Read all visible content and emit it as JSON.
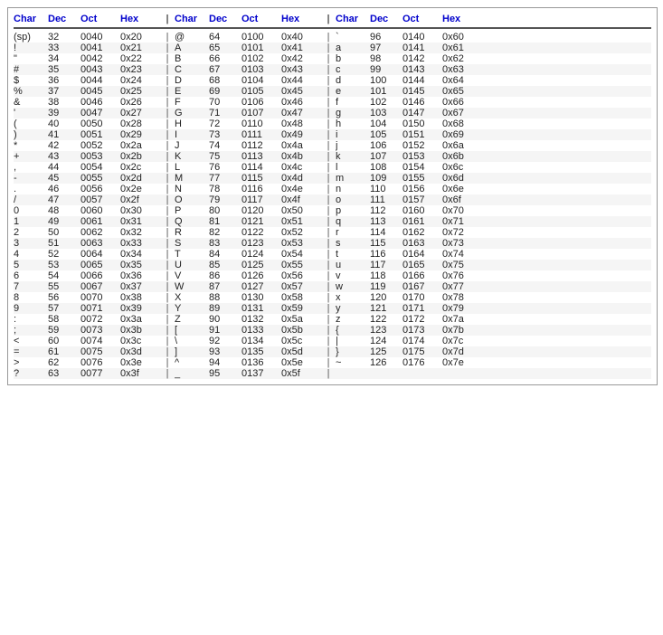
{
  "columns": [
    {
      "id": "char",
      "label": "Char"
    },
    {
      "id": "dec",
      "label": "Dec"
    },
    {
      "id": "oct",
      "label": "Oct"
    },
    {
      "id": "hex",
      "label": "Hex"
    }
  ],
  "rows": [
    [
      "(sp)",
      "32",
      "0040",
      "0x20",
      "@",
      "64",
      "0100",
      "0x40",
      "`",
      "96",
      "0140",
      "0x60"
    ],
    [
      "!",
      "33",
      "0041",
      "0x21",
      "A",
      "65",
      "0101",
      "0x41",
      "a",
      "97",
      "0141",
      "0x61"
    ],
    [
      "\"",
      "34",
      "0042",
      "0x22",
      "B",
      "66",
      "0102",
      "0x42",
      "b",
      "98",
      "0142",
      "0x62"
    ],
    [
      "#",
      "35",
      "0043",
      "0x23",
      "C",
      "67",
      "0103",
      "0x43",
      "c",
      "99",
      "0143",
      "0x63"
    ],
    [
      "$",
      "36",
      "0044",
      "0x24",
      "D",
      "68",
      "0104",
      "0x44",
      "d",
      "100",
      "0144",
      "0x64"
    ],
    [
      "%",
      "37",
      "0045",
      "0x25",
      "E",
      "69",
      "0105",
      "0x45",
      "e",
      "101",
      "0145",
      "0x65"
    ],
    [
      "&",
      "38",
      "0046",
      "0x26",
      "F",
      "70",
      "0106",
      "0x46",
      "f",
      "102",
      "0146",
      "0x66"
    ],
    [
      "'",
      "39",
      "0047",
      "0x27",
      "G",
      "71",
      "0107",
      "0x47",
      "g",
      "103",
      "0147",
      "0x67"
    ],
    [
      "(",
      "40",
      "0050",
      "0x28",
      "H",
      "72",
      "0110",
      "0x48",
      "h",
      "104",
      "0150",
      "0x68"
    ],
    [
      ")",
      "41",
      "0051",
      "0x29",
      "I",
      "73",
      "0111",
      "0x49",
      "i",
      "105",
      "0151",
      "0x69"
    ],
    [
      "*",
      "42",
      "0052",
      "0x2a",
      "J",
      "74",
      "0112",
      "0x4a",
      "j",
      "106",
      "0152",
      "0x6a"
    ],
    [
      "+",
      "43",
      "0053",
      "0x2b",
      "K",
      "75",
      "0113",
      "0x4b",
      "k",
      "107",
      "0153",
      "0x6b"
    ],
    [
      ",",
      "44",
      "0054",
      "0x2c",
      "L",
      "76",
      "0114",
      "0x4c",
      "l",
      "108",
      "0154",
      "0x6c"
    ],
    [
      "-",
      "45",
      "0055",
      "0x2d",
      "M",
      "77",
      "0115",
      "0x4d",
      "m",
      "109",
      "0155",
      "0x6d"
    ],
    [
      ".",
      "46",
      "0056",
      "0x2e",
      "N",
      "78",
      "0116",
      "0x4e",
      "n",
      "110",
      "0156",
      "0x6e"
    ],
    [
      "/",
      "47",
      "0057",
      "0x2f",
      "O",
      "79",
      "0117",
      "0x4f",
      "o",
      "111",
      "0157",
      "0x6f"
    ],
    [
      "0",
      "48",
      "0060",
      "0x30",
      "P",
      "80",
      "0120",
      "0x50",
      "p",
      "112",
      "0160",
      "0x70"
    ],
    [
      "1",
      "49",
      "0061",
      "0x31",
      "Q",
      "81",
      "0121",
      "0x51",
      "q",
      "113",
      "0161",
      "0x71"
    ],
    [
      "2",
      "50",
      "0062",
      "0x32",
      "R",
      "82",
      "0122",
      "0x52",
      "r",
      "114",
      "0162",
      "0x72"
    ],
    [
      "3",
      "51",
      "0063",
      "0x33",
      "S",
      "83",
      "0123",
      "0x53",
      "s",
      "115",
      "0163",
      "0x73"
    ],
    [
      "4",
      "52",
      "0064",
      "0x34",
      "T",
      "84",
      "0124",
      "0x54",
      "t",
      "116",
      "0164",
      "0x74"
    ],
    [
      "5",
      "53",
      "0065",
      "0x35",
      "U",
      "85",
      "0125",
      "0x55",
      "u",
      "117",
      "0165",
      "0x75"
    ],
    [
      "6",
      "54",
      "0066",
      "0x36",
      "V",
      "86",
      "0126",
      "0x56",
      "v",
      "118",
      "0166",
      "0x76"
    ],
    [
      "7",
      "55",
      "0067",
      "0x37",
      "W",
      "87",
      "0127",
      "0x57",
      "w",
      "119",
      "0167",
      "0x77"
    ],
    [
      "8",
      "56",
      "0070",
      "0x38",
      "X",
      "88",
      "0130",
      "0x58",
      "x",
      "120",
      "0170",
      "0x78"
    ],
    [
      "9",
      "57",
      "0071",
      "0x39",
      "Y",
      "89",
      "0131",
      "0x59",
      "y",
      "121",
      "0171",
      "0x79"
    ],
    [
      ":",
      "58",
      "0072",
      "0x3a",
      "Z",
      "90",
      "0132",
      "0x5a",
      "z",
      "122",
      "0172",
      "0x7a"
    ],
    [
      ";",
      "59",
      "0073",
      "0x3b",
      "[",
      "91",
      "0133",
      "0x5b",
      "{",
      "123",
      "0173",
      "0x7b"
    ],
    [
      "<",
      "60",
      "0074",
      "0x3c",
      "\\",
      "92",
      "0134",
      "0x5c",
      "|",
      "124",
      "0174",
      "0x7c"
    ],
    [
      "=",
      "61",
      "0075",
      "0x3d",
      "]",
      "93",
      "0135",
      "0x5d",
      "}",
      "125",
      "0175",
      "0x7d"
    ],
    [
      ">",
      "62",
      "0076",
      "0x3e",
      "^",
      "94",
      "0136",
      "0x5e",
      "~",
      "126",
      "0176",
      "0x7e"
    ],
    [
      "?",
      "63",
      "0077",
      "0x3f",
      "_",
      "95",
      "0137",
      "0x5f",
      "",
      "",
      "",
      ""
    ]
  ],
  "separator": "|"
}
